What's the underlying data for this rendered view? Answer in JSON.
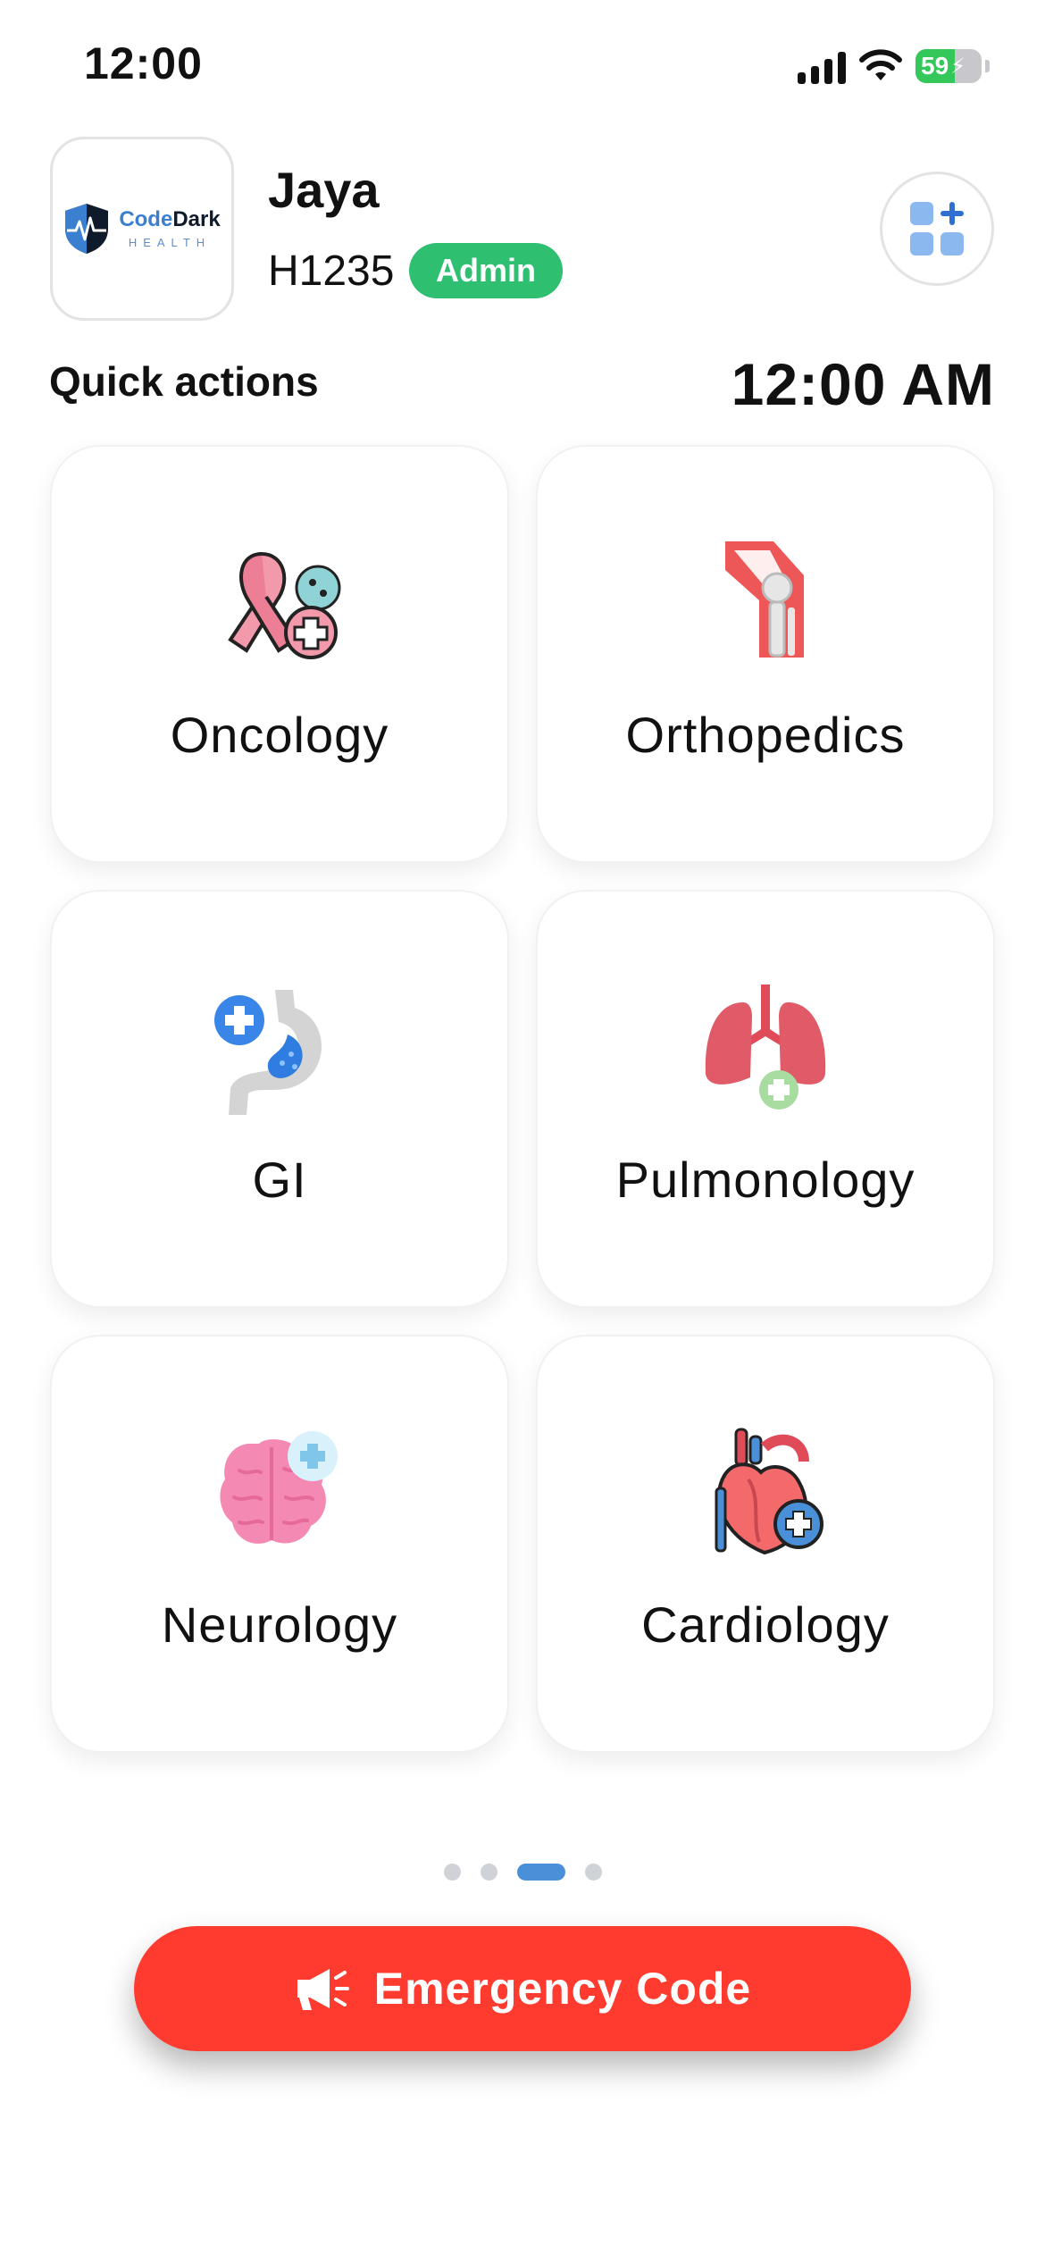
{
  "status_bar": {
    "time": "12:00",
    "battery": "59"
  },
  "header": {
    "logo_main_a": "Code",
    "logo_main_b": "Dark",
    "logo_sub": "HEALTH",
    "user_name": "Jaya",
    "user_id": "H1235",
    "role": "Admin"
  },
  "quick_actions": {
    "title": "Quick actions",
    "clock": "12:00 AM",
    "cards": [
      {
        "label": "Oncology",
        "icon": "cancer-ribbon-icon"
      },
      {
        "label": "Orthopedics",
        "icon": "knee-joint-icon"
      },
      {
        "label": "GI",
        "icon": "stomach-icon"
      },
      {
        "label": "Pulmonology",
        "icon": "lungs-icon"
      },
      {
        "label": "Neurology",
        "icon": "brain-icon"
      },
      {
        "label": "Cardiology",
        "icon": "heart-icon"
      }
    ]
  },
  "pager": {
    "pages": 4,
    "active_index": 2
  },
  "emergency": {
    "label": "Emergency Code",
    "icon": "megaphone-icon",
    "color": "#ff3b2f"
  },
  "colors": {
    "admin_badge": "#2fbf71",
    "accent": "#4a90d9"
  }
}
